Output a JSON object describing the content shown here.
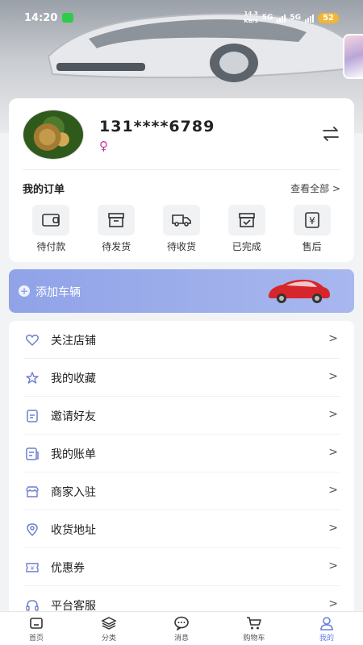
{
  "status_bar": {
    "time": "14:20",
    "network_speed": "14.3",
    "network_unit": "KB/s",
    "signal1": "5G",
    "signal2": "5G",
    "battery": "52"
  },
  "user": {
    "phone": "131****6789",
    "gender_symbol": "♀"
  },
  "orders": {
    "title": "我的订单",
    "view_all": "查看全部 >",
    "items": [
      {
        "label": "待付款",
        "icon": "wallet-icon"
      },
      {
        "label": "待发货",
        "icon": "box-icon"
      },
      {
        "label": "待收货",
        "icon": "truck-icon"
      },
      {
        "label": "已完成",
        "icon": "completed-box-icon"
      },
      {
        "label": "售后",
        "icon": "after-sales-icon"
      }
    ]
  },
  "add_vehicle": {
    "label": "添加车辆"
  },
  "menu": {
    "items": [
      {
        "label": "关注店铺",
        "icon": "heart-icon",
        "arrow": ">"
      },
      {
        "label": "我的收藏",
        "icon": "star-icon",
        "arrow": ">"
      },
      {
        "label": "邀请好友",
        "icon": "invite-icon",
        "arrow": ">"
      },
      {
        "label": "我的账单",
        "icon": "bill-icon",
        "arrow": ">"
      },
      {
        "label": "商家入驻",
        "icon": "store-icon",
        "arrow": ">"
      },
      {
        "label": "收货地址",
        "icon": "location-icon",
        "arrow": ">"
      },
      {
        "label": "优惠券",
        "icon": "coupon-icon",
        "arrow": ">"
      },
      {
        "label": "平台客服",
        "icon": "headset-icon",
        "arrow": ">"
      }
    ]
  },
  "tabbar": {
    "tabs": [
      {
        "label": "首页",
        "icon": "home-icon"
      },
      {
        "label": "分类",
        "icon": "category-icon"
      },
      {
        "label": "消息",
        "icon": "message-icon"
      },
      {
        "label": "购物车",
        "icon": "cart-icon"
      },
      {
        "label": "我的",
        "icon": "profile-icon"
      }
    ],
    "active_index": 4,
    "active_color": "#6a7de0"
  },
  "colors": {
    "accent": "#90a3e8",
    "gender": "#c2389a",
    "battery": "#f2b632"
  }
}
